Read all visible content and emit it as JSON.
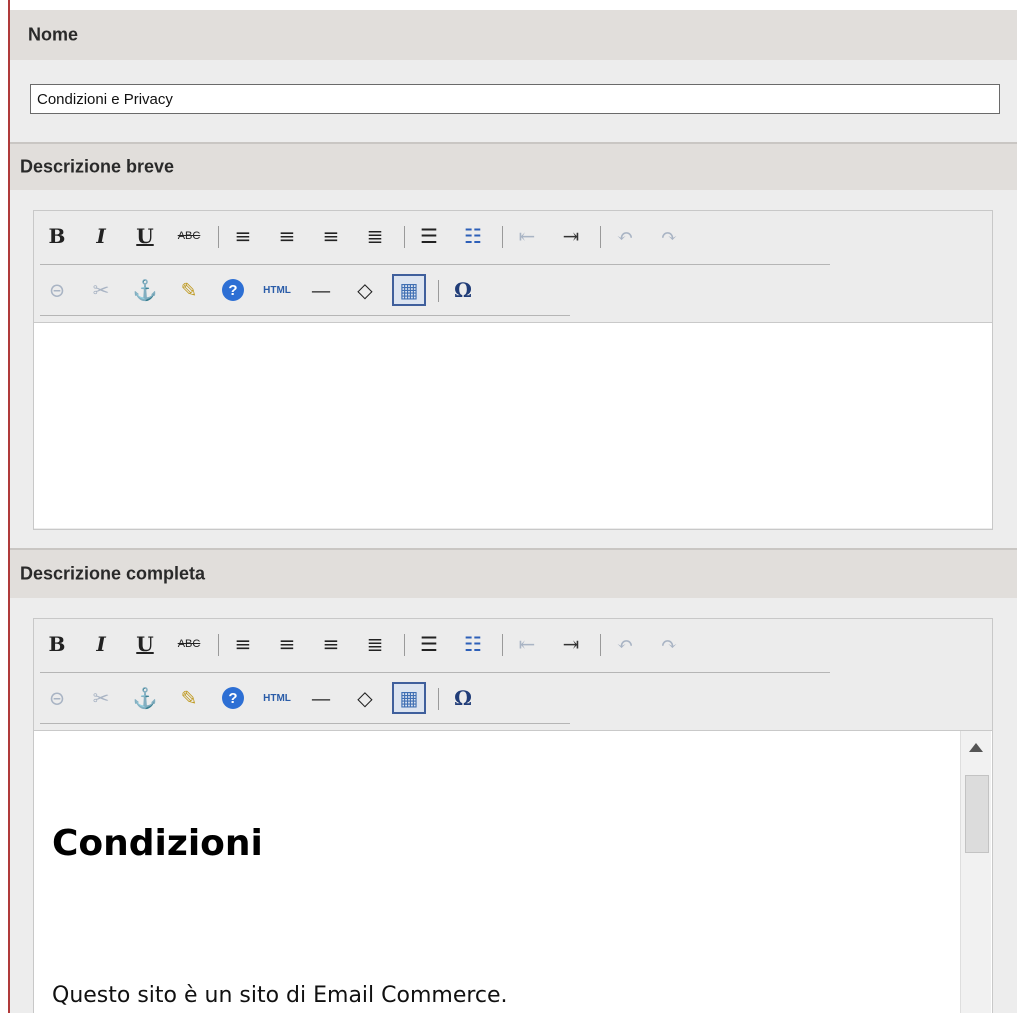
{
  "nome": {
    "label": "Nome",
    "value": "Condizioni e Privacy"
  },
  "descrizione_breve": {
    "label": "Descrizione breve"
  },
  "descrizione_completa": {
    "label": "Descrizione completa",
    "content_heading": "Condizioni",
    "content_paragraph": "Questo sito è un sito di Email Commerce."
  },
  "toolbar": {
    "row1": [
      {
        "name": "bold-button",
        "glyph": "B",
        "dim": false
      },
      {
        "name": "italic-button",
        "glyph": "I",
        "dim": false
      },
      {
        "name": "underline-button",
        "glyph": "U",
        "dim": false
      },
      {
        "name": "strikethrough-button",
        "glyph": "ABC",
        "dim": false
      },
      {
        "sep": true
      },
      {
        "name": "align-left-button",
        "glyph": "≡",
        "dim": false
      },
      {
        "name": "align-center-button",
        "glyph": "≡",
        "dim": false
      },
      {
        "name": "align-right-button",
        "glyph": "≡",
        "dim": false
      },
      {
        "name": "align-justify-button",
        "glyph": "≣",
        "dim": false
      },
      {
        "sep": true
      },
      {
        "name": "bullet-list-button",
        "glyph": "☰",
        "dim": false
      },
      {
        "name": "numbered-list-button",
        "glyph": "☷",
        "dim": false
      },
      {
        "sep": true
      },
      {
        "name": "outdent-button",
        "glyph": "⇤",
        "dim": true
      },
      {
        "name": "indent-button",
        "glyph": "⇥",
        "dim": false
      },
      {
        "sep": true
      },
      {
        "name": "undo-button",
        "glyph": "↶",
        "dim": true
      },
      {
        "name": "redo-button",
        "glyph": "↷",
        "dim": true
      }
    ],
    "row2": [
      {
        "name": "link-button",
        "glyph": "⊝",
        "dim": true
      },
      {
        "name": "unlink-button",
        "glyph": "✂",
        "dim": true
      },
      {
        "name": "anchor-button",
        "glyph": "⚓",
        "dim": false
      },
      {
        "name": "cleanup-button",
        "glyph": "✎",
        "dim": false
      },
      {
        "name": "help-button",
        "glyph": "?",
        "dim": false
      },
      {
        "name": "html-source-button",
        "glyph": "HTML",
        "dim": false
      },
      {
        "name": "horizontal-rule-button",
        "glyph": "—",
        "dim": false
      },
      {
        "name": "remove-format-button",
        "glyph": "◇",
        "dim": false
      },
      {
        "name": "table-button",
        "glyph": "▦",
        "dim": false,
        "active": true
      },
      {
        "sep": true
      },
      {
        "name": "special-char-button",
        "glyph": "Ω",
        "dim": false
      }
    ]
  }
}
